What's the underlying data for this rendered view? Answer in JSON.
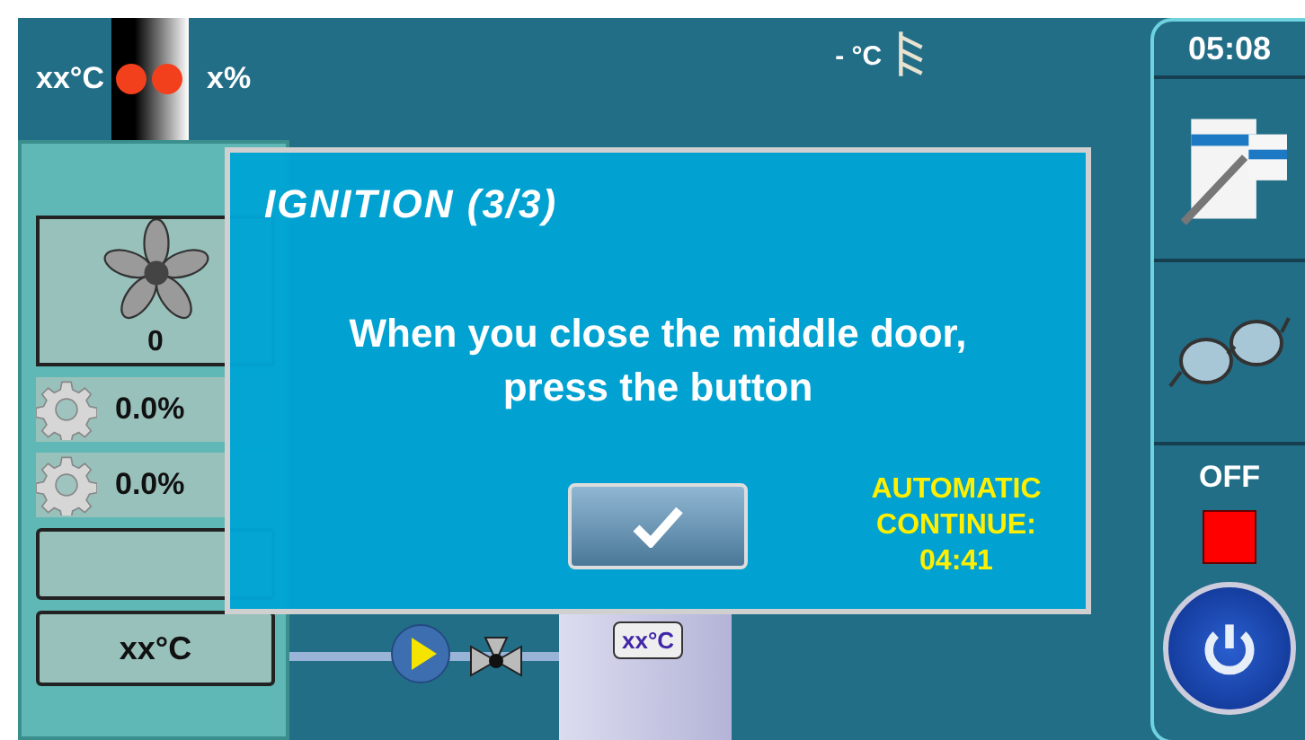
{
  "status": {
    "flue_temp": "xx°C",
    "fan_percent": "x%",
    "outdoor_temp": "- °C"
  },
  "boiler": {
    "fan_speed": "0",
    "actuators": [
      "0.0%",
      "0.0%"
    ],
    "temperature": "xx°C"
  },
  "tank": {
    "temperature": "xx°C"
  },
  "sidebar": {
    "time": "05:08",
    "state_label": "OFF",
    "on": false
  },
  "dialog": {
    "title": "IGNITION (3/3)",
    "message": "When you close the middle door, press the button",
    "auto_label": "AUTOMATIC CONTINUE:",
    "countdown": "04:41"
  }
}
